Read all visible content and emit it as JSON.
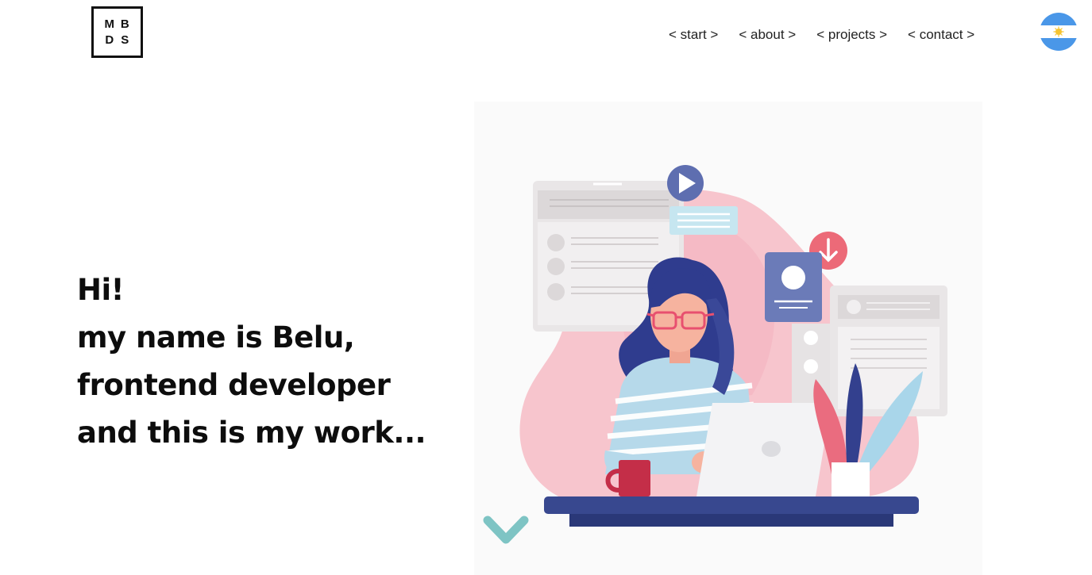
{
  "logo": {
    "letters": [
      "M",
      "B",
      "D",
      "S"
    ]
  },
  "nav": {
    "items": [
      {
        "label": "< start >"
      },
      {
        "label": "< about >"
      },
      {
        "label": "< projects >"
      },
      {
        "label": "< contact >"
      }
    ]
  },
  "language": {
    "flag_icon": "argentina-flag-icon"
  },
  "hero": {
    "lines": [
      "Hi!",
      "my name is Belu,",
      "frontend developer",
      "and this is my work..."
    ]
  },
  "illustration": {
    "icon": "woman-at-laptop-illustration"
  },
  "scroll": {
    "icon": "chevron-down-icon"
  },
  "colors": {
    "text": "#0d0d0d",
    "chevron": "#7ec4c4",
    "desk": "#2e3f8f",
    "pink": "#f6c1c9",
    "navy": "#3b4ea0"
  }
}
